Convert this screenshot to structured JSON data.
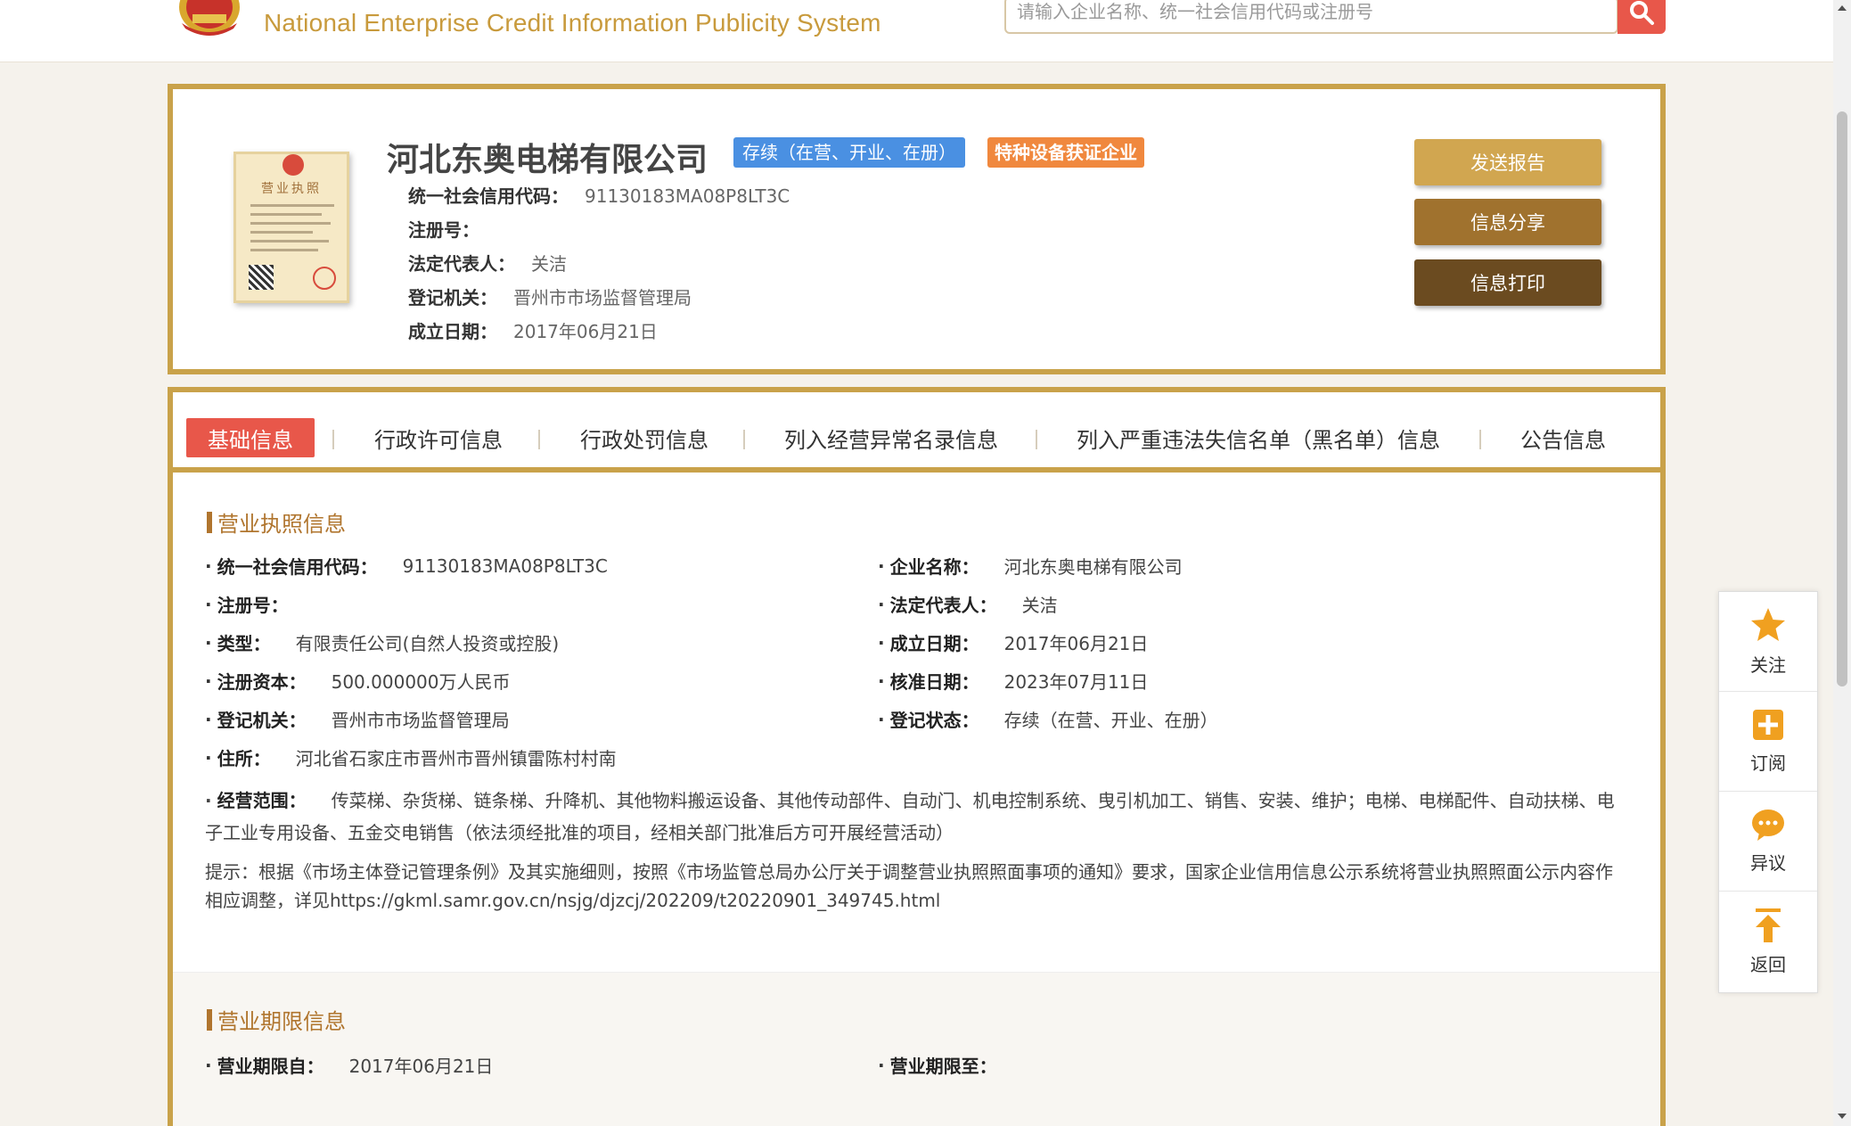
{
  "header": {
    "site_title": "National Enterprise Credit Information Publicity System",
    "search_placeholder": "请输入企业名称、统一社会信用代码或注册号"
  },
  "company": {
    "name": "河北东奥电梯有限公司",
    "status_tag": "存续（在营、开业、在册）",
    "special_tag": "特种设备获证企业",
    "rows": [
      {
        "label": "统一社会信用代码：",
        "value": "91130183MA08P8LT3C"
      },
      {
        "label": "注册号：",
        "value": ""
      },
      {
        "label": "法定代表人：",
        "value": "关洁"
      },
      {
        "label": "登记机关：",
        "value": "晋州市市场监督管理局"
      },
      {
        "label": "成立日期：",
        "value": "2017年06月21日"
      }
    ],
    "license_thumb_title": "营业执照",
    "buttons": {
      "send": "发送报告",
      "share": "信息分享",
      "print": "信息打印"
    }
  },
  "tabs": [
    {
      "label": "基础信息",
      "active": true
    },
    {
      "label": "行政许可信息"
    },
    {
      "label": "行政处罚信息"
    },
    {
      "label": "列入经营异常名录信息"
    },
    {
      "label": "列入严重违法失信名单（黑名单）信息"
    },
    {
      "label": "公告信息"
    }
  ],
  "license_section": {
    "title": "营业执照信息",
    "left": [
      {
        "label": "统一社会信用代码：",
        "value": "91130183MA08P8LT3C"
      },
      {
        "label": "注册号：",
        "value": ""
      },
      {
        "label": "类型：",
        "value": "有限责任公司(自然人投资或控股)"
      },
      {
        "label": "注册资本：",
        "value": "500.000000万人民币"
      },
      {
        "label": "登记机关：",
        "value": "晋州市市场监督管理局"
      },
      {
        "label": "住所：",
        "value": "河北省石家庄市晋州市晋州镇雷陈村村南"
      }
    ],
    "right": [
      {
        "label": "企业名称：",
        "value": "河北东奥电梯有限公司"
      },
      {
        "label": "法定代表人：",
        "value": "关洁"
      },
      {
        "label": "成立日期：",
        "value": "2017年06月21日"
      },
      {
        "label": "核准日期：",
        "value": "2023年07月11日"
      },
      {
        "label": "登记状态：",
        "value": "存续（在营、开业、在册）"
      }
    ],
    "scope_label": "经营范围：",
    "scope_value": "传菜梯、杂货梯、链条梯、升降机、其他物料搬运设备、其他传动部件、自动门、机电控制系统、曳引机加工、销售、安装、维护；电梯、电梯配件、自动扶梯、电子工业专用设备、五金交电销售（依法须经批准的项目，经相关部门批准后方可开展经营活动）",
    "tip": "提示：根据《市场主体登记管理条例》及其实施细则，按照《市场监管总局办公厅关于调整营业执照照面事项的通知》要求，国家企业信用信息公示系统将营业执照照面公示内容作相应调整，详见https://gkml.samr.gov.cn/nsjg/djzcj/202209/t20220901_349745.html"
  },
  "term_section": {
    "title": "营业期限信息",
    "from_label": "营业期限自：",
    "from_value": "2017年06月21日",
    "to_label": "营业期限至：",
    "to_value": ""
  },
  "float_bar": [
    {
      "label": "关注",
      "icon": "star-icon"
    },
    {
      "label": "订阅",
      "icon": "plus-icon"
    },
    {
      "label": "异议",
      "icon": "chat-icon"
    },
    {
      "label": "返回",
      "icon": "arrow-up-icon"
    }
  ],
  "colors": {
    "gold_border": "#c9a24a",
    "active_tab": "#e8574a",
    "status_tag": "#4a90e2",
    "special_tag": "#f0883e",
    "section_title": "#b0752e",
    "icon_orange": "#f0a020"
  }
}
